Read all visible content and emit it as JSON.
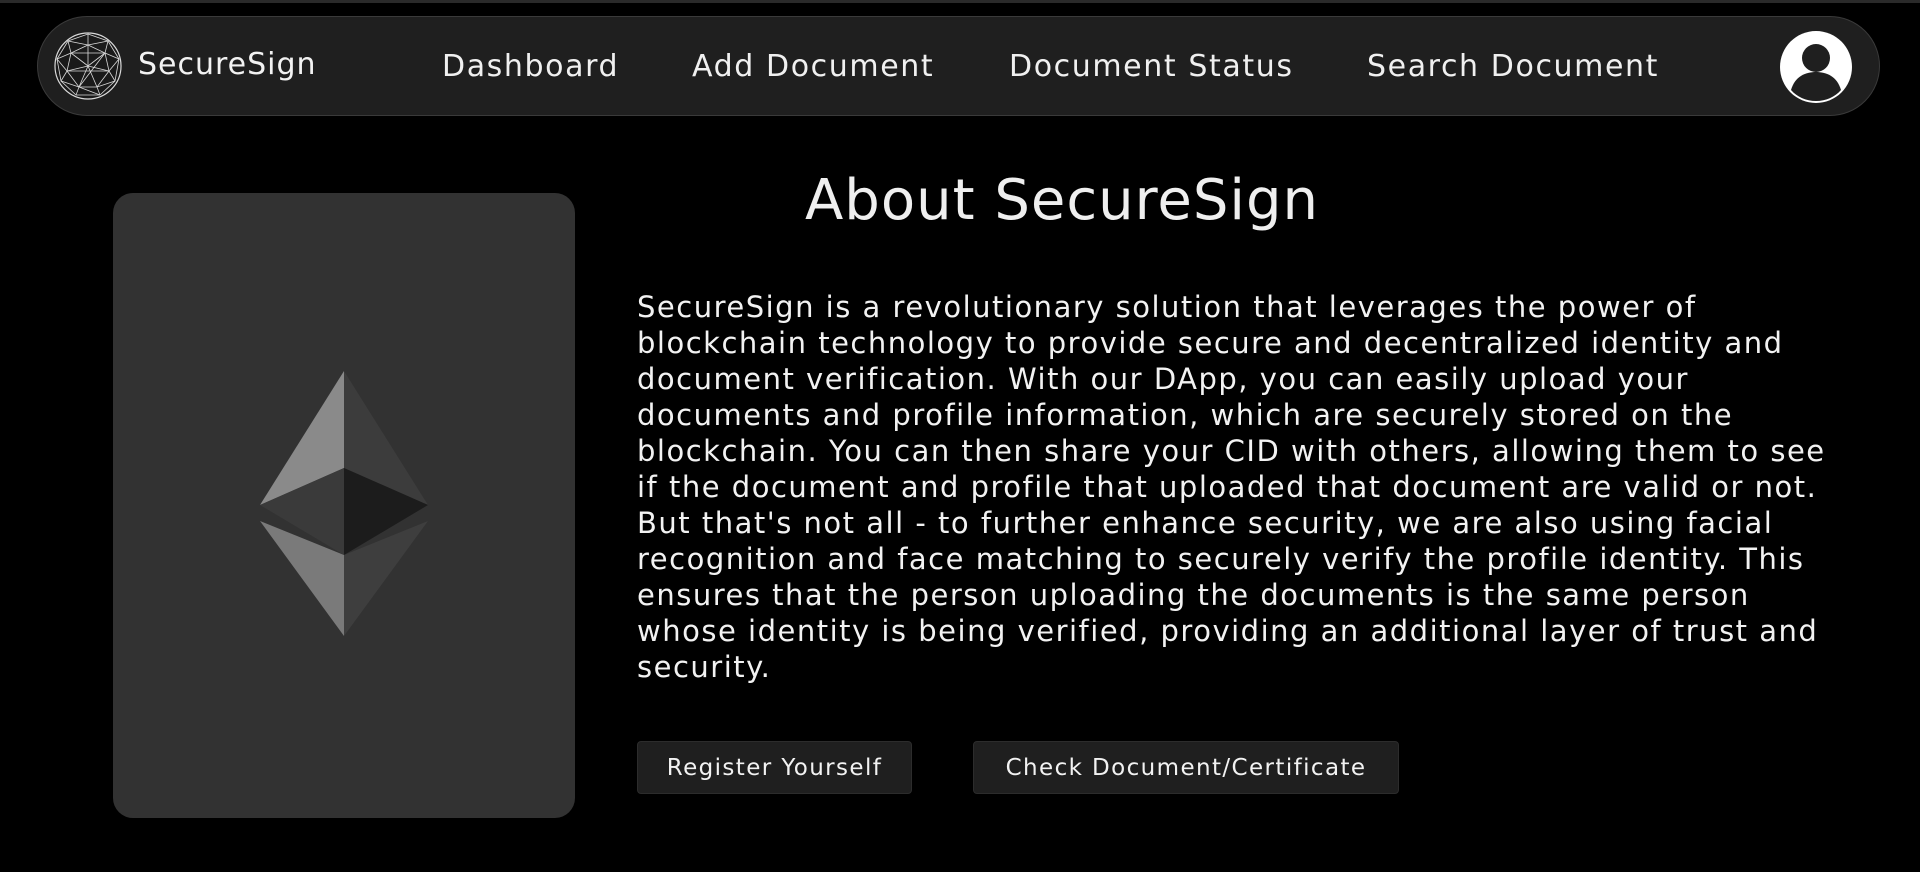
{
  "navbar": {
    "brand": "SecureSign",
    "logo_icon": "globe-network-icon",
    "links": [
      {
        "label": "Dashboard"
      },
      {
        "label": "Add Document"
      },
      {
        "label": "Document Status"
      },
      {
        "label": "Search Document"
      }
    ],
    "avatar_icon": "user-avatar-icon"
  },
  "hero": {
    "card_icon": "ethereum-icon",
    "title": "About SecureSign",
    "description": "SecureSign is a revolutionary solution that leverages the power of blockchain technology to provide secure and decentralized identity and document verification. With our DApp, you can easily upload your documents and profile information, which are securely stored on the blockchain. You can then share your CID with others, allowing them to see if the document and profile that uploaded that document are valid or not. But that's not all - to further enhance security, we are also using facial recognition and face matching to securely verify the profile identity. This ensures that the person uploading the documents is the same person whose identity is being verified, providing an additional layer of trust and security.",
    "buttons": {
      "register": "Register Yourself",
      "check": "Check Document/Certificate"
    }
  },
  "colors": {
    "background": "#000000",
    "navbar": "#1f1f1f",
    "card": "#323232",
    "button": "#1f1f1f",
    "text": "#f2f2f2"
  }
}
